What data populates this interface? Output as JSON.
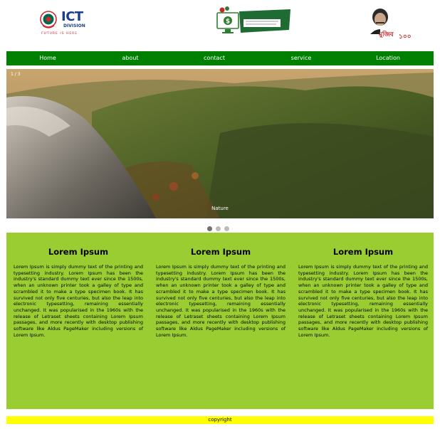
{
  "header": {
    "logo_left": {
      "text": "ICT",
      "subtext": "DIVISION",
      "tagline": "FUTURE IS HERE"
    },
    "logo_center": {
      "text": ""
    },
    "logo_right": {
      "text": "মুজিব",
      "year_text": "১০০"
    }
  },
  "nav": {
    "items": [
      {
        "label": "Home"
      },
      {
        "label": "about"
      },
      {
        "label": "contact"
      },
      {
        "label": "service"
      },
      {
        "label": "Location"
      }
    ]
  },
  "slider": {
    "counter": "1 / 3",
    "caption": "Nature",
    "slide_count": 3,
    "active_index": 1
  },
  "columns": [
    {
      "title": "Lorem Ipsum",
      "body": "Lorem Ipsum is simply dummy text of the printing and typesetting industry. Lorem Ipsum has been the industry's standard dummy text ever since the 1500s, when an unknown printer took a galley of type and scrambled it to make a type specimen book. It has survived not only five centuries, but also the leap into electronic typesetting, remaining essentially unchanged. It was popularised in the 1960s with the release of Letraset sheets containing Lorem Ipsum passages, and more recently with desktop publishing software like Aldus PageMaker including versions of Lorem Ipsum."
    },
    {
      "title": "Lorem Ipsum",
      "body": "Lorem Ipsum is simply dummy text of the printing and typesetting industry. Lorem Ipsum has been the industry's standard dummy text ever since the 1500s, when an unknown printer took a galley of type and scrambled it to make a type specimen book. It has survived not only five centuries, but also the leap into electronic typesetting, remaining essentially unchanged. It was popularised in the 1960s with the release of Letraset sheets containing Lorem Ipsum passages, and more recently with desktop publishing software like Aldus PageMaker including versions of Lorem Ipsum."
    },
    {
      "title": "Lorem Ipsum",
      "body": "Lorem Ipsum is simply dummy text of the printing and typesetting industry. Lorem Ipsum has been the industry's standard dummy text ever since the 1500s, when an unknown printer took a galley of type and scrambled it to make a type specimen book. It has survived not only five centuries, but also the leap into electronic typesetting, remaining essentially unchanged. It was popularised in the 1960s with the release of Letraset sheets containing Lorem Ipsum passages, and more recently with desktop publishing software like Aldus PageMaker including versions of Lorem Ipsum."
    }
  ],
  "footer": {
    "text": "copyright"
  },
  "colors": {
    "nav_bg": "#008000",
    "content_bg": "#9acd32",
    "footer_bg": "#ffff00",
    "ict_blue": "#1b3f8f",
    "ict_red": "#d6242a",
    "bd_green": "#006a4e"
  }
}
